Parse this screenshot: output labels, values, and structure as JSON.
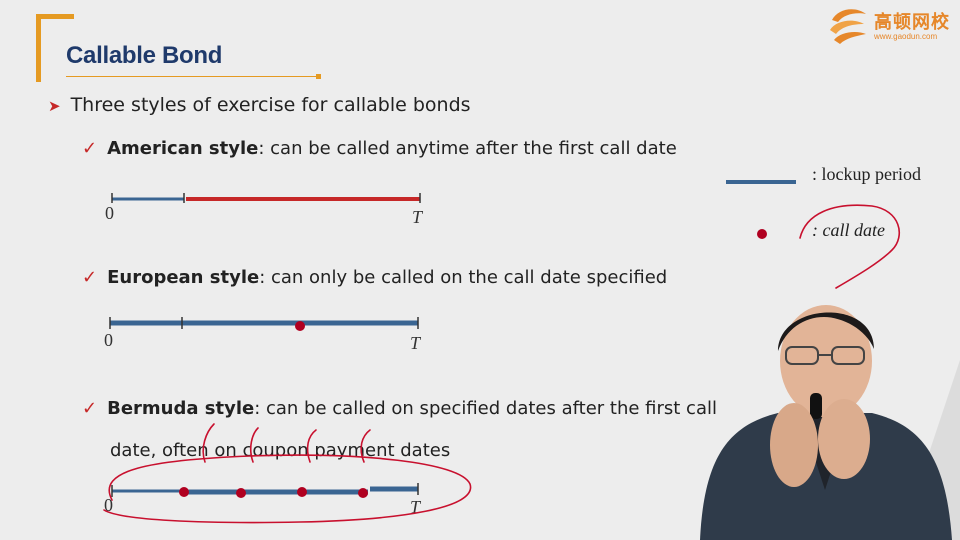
{
  "slide": {
    "title": "Callable Bond",
    "main_bullet": "Three styles of exercise for callable bonds",
    "styles": [
      {
        "name": "American style",
        "desc": ": can be called anytime after the first call date"
      },
      {
        "name": "European style",
        "desc": ": can only be called on the call date specified"
      },
      {
        "name": "Bermuda style",
        "desc": ": can be called on specified dates after the first call",
        "desc_cont": "date, often on coupon payment dates"
      }
    ],
    "axis": {
      "start": "0",
      "end": "T"
    },
    "legend": {
      "lockup": ": lockup period",
      "call": ": call date"
    }
  },
  "logo": {
    "name": "高顿网校",
    "url": "www.gaodun.com"
  },
  "colors": {
    "title": "#1f3a6b",
    "accent_orange": "#e59a22",
    "lockup_blue": "#3a6592",
    "call_red": "#b00020",
    "annotation_red": "#c8102e"
  },
  "icons": [
    "arrow-bullet-icon",
    "check-icon",
    "logo-icon"
  ]
}
